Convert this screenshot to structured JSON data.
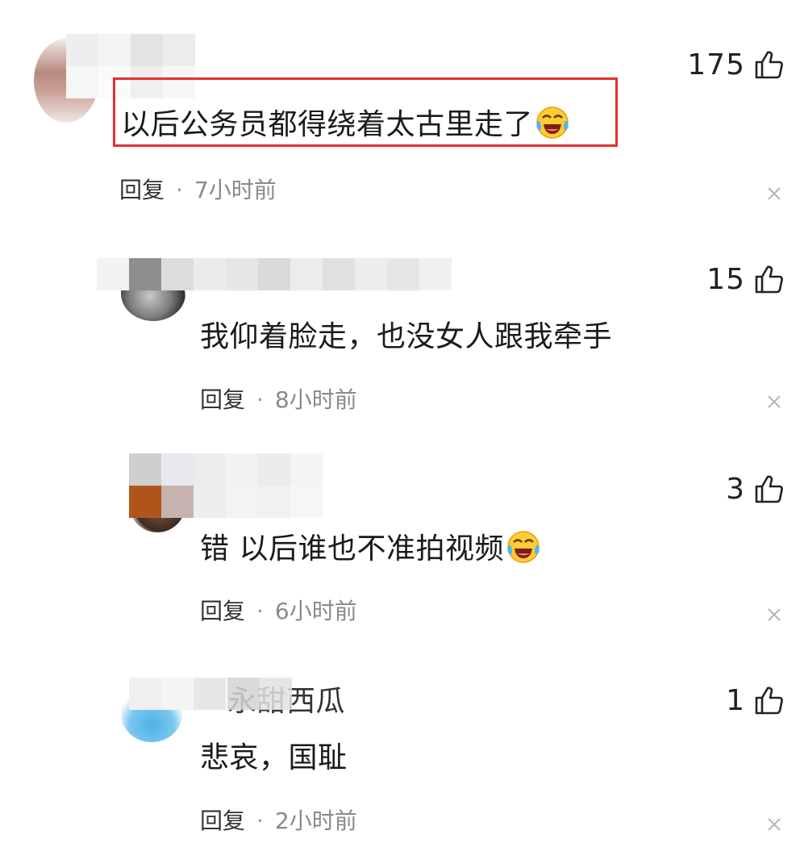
{
  "comments": [
    {
      "text": "以后公务员都得绕着太古里走了",
      "has_emoji": true,
      "emoji": "crying-laughing-emoji",
      "likes": "175",
      "reply_label": "回复",
      "dot": "·",
      "time": "7小时前",
      "highlighted": true
    },
    {
      "text": "我仰着脸走，也没女人跟我牵手",
      "has_emoji": false,
      "likes": "15",
      "reply_label": "回复",
      "dot": "·",
      "time": "8小时前"
    },
    {
      "text": "错 以后谁也不准拍视频",
      "has_emoji": true,
      "emoji": "crying-laughing-emoji",
      "likes": "3",
      "reply_label": "回复",
      "dot": "·",
      "time": "6小时前"
    },
    {
      "username_fragment": "永甜西瓜",
      "text": "悲哀，国耻",
      "has_emoji": false,
      "likes": "1",
      "reply_label": "回复",
      "dot": "·",
      "time": "2小时前"
    }
  ],
  "colors": {
    "highlight_border": "#e4312f",
    "time_text": "#8a8a8a",
    "body_text": "#1a1a1a"
  },
  "icons": [
    "thumbs-up-icon",
    "close-icon",
    "crying-laughing-emoji"
  ]
}
